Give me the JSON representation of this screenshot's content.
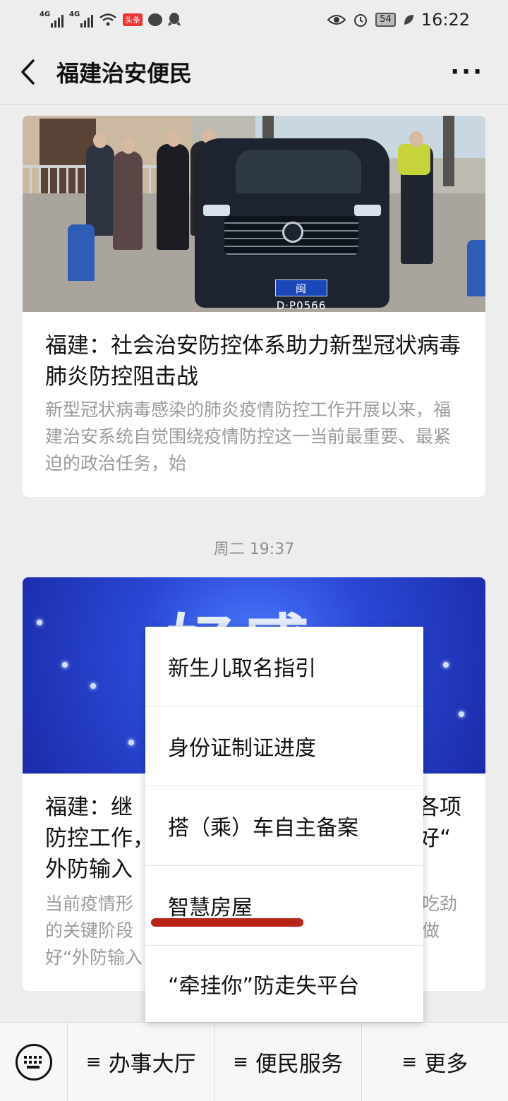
{
  "status_bar": {
    "network_1": "4G",
    "network_2": "4G",
    "news_badge": "头条",
    "battery": "54",
    "time": "16:22",
    "icons": [
      "signal-icon",
      "signal-icon",
      "wifi-icon",
      "news-app-icon",
      "chat-bubble-icon",
      "qq-icon",
      "eye-icon",
      "alarm-icon",
      "battery-icon",
      "leaf-icon"
    ]
  },
  "header": {
    "title": "福建治安便民",
    "back_icon": "chevron-left-icon",
    "more_label": "···"
  },
  "articles": [
    {
      "title": "福建：社会治安防控体系助力新型冠状病毒肺炎防控阻击战",
      "summary": "新型冠状病毒感染的肺炎疫情防控工作开展以来，福建治安系统自觉围绕疫情防控这一当前最重要、最紧迫的政治任务，始",
      "plate": "闽D·P0566"
    },
    {
      "banner_text": "好感",
      "title_lines": [
        "福建：继",
        "防控工作，",
        "外防输入"
      ],
      "title_right": [
        "各项",
        "好“"
      ],
      "summary_lines": [
        "当前疫情形",
        "的关键阶段",
        "好“外防输入"
      ],
      "summary_right": [
        "吃劲",
        "做"
      ]
    }
  ],
  "date_separator": "周二 19:37",
  "popup_menu": {
    "items": [
      "新生儿取名指引",
      "身份证制证进度",
      "搭（乘）车自主备案",
      "智慧房屋",
      "“牵挂你”防走失平台"
    ],
    "highlight_color": "#b8231a"
  },
  "bottom_bar": {
    "keyboard_icon": "keyboard-icon",
    "items": [
      "办事大厅",
      "便民服务",
      "更多"
    ],
    "menu_glyph": "≡"
  },
  "colors": {
    "background": "#ededed",
    "banner_blue": "#2a48d6",
    "card": "#ffffff"
  }
}
